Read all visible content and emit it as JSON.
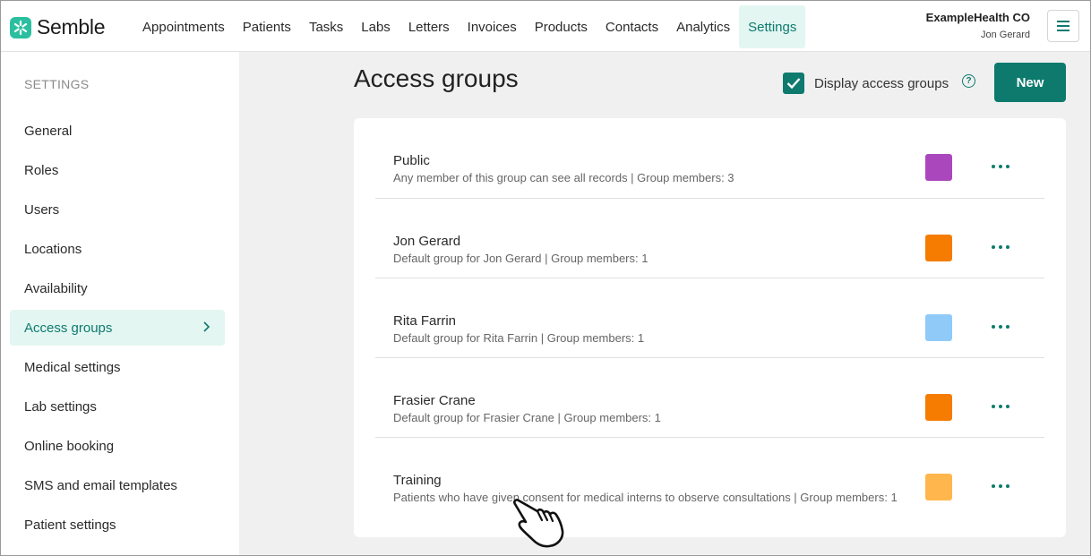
{
  "app": {
    "logo_text": "Semble",
    "brand_color": "#0e7a6e",
    "logo_color": "#2bbf9f"
  },
  "nav": {
    "items": [
      "Appointments",
      "Patients",
      "Tasks",
      "Labs",
      "Letters",
      "Invoices",
      "Products",
      "Contacts",
      "Analytics",
      "Settings"
    ],
    "active": "Settings"
  },
  "org": {
    "name": "ExampleHealth CO",
    "user": "Jon Gerard"
  },
  "sidebar": {
    "heading": "SETTINGS",
    "items": [
      "General",
      "Roles",
      "Users",
      "Locations",
      "Availability",
      "Access groups",
      "Medical settings",
      "Lab settings",
      "Online booking",
      "SMS and email templates",
      "Patient settings"
    ],
    "active": "Access groups"
  },
  "main": {
    "title": "Access groups",
    "display_toggle": {
      "label": "Display access groups",
      "checked": true
    },
    "help_glyph": "?",
    "new_button": "New"
  },
  "groups": [
    {
      "name": "Public",
      "description": "Any member of this group can see all records | Group members: 3",
      "color": "#ab47bc"
    },
    {
      "name": "Jon Gerard",
      "description": "Default group for Jon Gerard | Group members: 1",
      "color": "#f57c00"
    },
    {
      "name": "Rita Farrin",
      "description": "Default group for Rita Farrin | Group members: 1",
      "color": "#90caf9"
    },
    {
      "name": "Frasier Crane",
      "description": "Default group for Frasier Crane | Group members: 1",
      "color": "#f57c00"
    },
    {
      "name": "Training",
      "description": "Patients who have given consent for medical interns to observe consultations | Group members: 1",
      "color": "#ffb74d"
    }
  ]
}
